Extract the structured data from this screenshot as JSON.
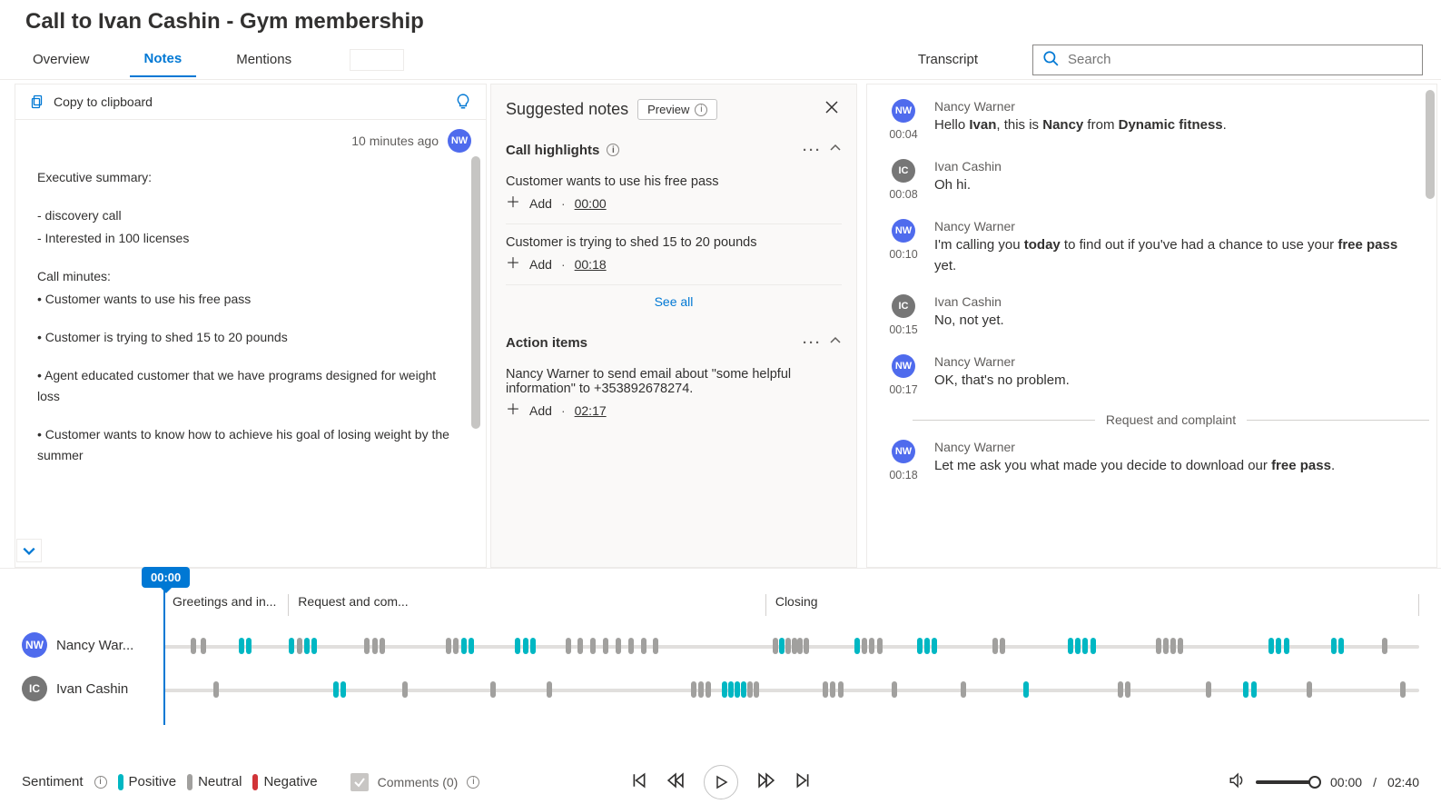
{
  "header": {
    "title": "Call to Ivan Cashin - Gym membership"
  },
  "tabs": {
    "overview": "Overview",
    "notes": "Notes",
    "mentions": "Mentions",
    "active": "notes"
  },
  "transcript_label": "Transcript",
  "search": {
    "placeholder": "Search"
  },
  "notes": {
    "copy_label": "Copy to clipboard",
    "meta": {
      "ago": "10 minutes ago",
      "initials": "NW"
    },
    "body_lines": [
      "Executive summary:",
      "",
      "- discovery call",
      "- Interested in 100 licenses",
      "",
      "Call minutes:",
      "• Customer wants to use his free pass",
      "",
      "• Customer is trying to shed 15 to 20 pounds",
      "",
      "• Agent educated customer that we have programs designed for weight loss",
      "",
      "• Customer wants to know how to achieve his goal of losing weight by the summer"
    ]
  },
  "suggested": {
    "title": "Suggested notes",
    "preview_label": "Preview",
    "highlights_title": "Call highlights",
    "action_items_title": "Action items",
    "add_label": "Add",
    "see_all": "See all",
    "highlights": [
      {
        "text": "Customer wants to use his free pass",
        "time": "00:00"
      },
      {
        "text": "Customer is trying to shed 15 to 20 pounds",
        "time": "00:18"
      }
    ],
    "action_items": [
      {
        "text": "Nancy Warner to send email about \"some helpful information\" to +353892678274.",
        "time": "02:17"
      }
    ]
  },
  "transcript": {
    "turns": [
      {
        "initials": "NW",
        "color": "blue",
        "name": "Nancy Warner",
        "time": "00:04",
        "html": "Hello <b>Ivan</b>, this is <b>Nancy</b> from <b>Dynamic fitness</b>."
      },
      {
        "initials": "IC",
        "color": "grey",
        "name": "Ivan Cashin",
        "time": "00:08",
        "html": "Oh hi."
      },
      {
        "initials": "NW",
        "color": "blue",
        "name": "Nancy Warner",
        "time": "00:10",
        "html": "I'm calling you <b>today</b> to find out if you've had a chance to use your <b>free pass</b> yet."
      },
      {
        "initials": "IC",
        "color": "grey",
        "name": "Ivan Cashin",
        "time": "00:15",
        "html": "No, not yet."
      },
      {
        "initials": "NW",
        "color": "blue",
        "name": "Nancy Warner",
        "time": "00:17",
        "html": "OK, that's no problem."
      }
    ],
    "divider": "Request and complaint",
    "after_divider": [
      {
        "initials": "NW",
        "color": "blue",
        "name": "Nancy Warner",
        "time": "00:18",
        "html": "Let me ask you what made you decide to download our <b>free pass</b>."
      }
    ]
  },
  "timeline": {
    "play_time": "00:00",
    "segments": [
      {
        "label": "Greetings and in...",
        "widthPct": 10
      },
      {
        "label": "Request and com...",
        "widthPct": 38
      },
      {
        "label": "Closing",
        "widthPct": 52
      }
    ],
    "speakers": [
      {
        "initials": "NW",
        "color": "blue",
        "name": "Nancy War..."
      },
      {
        "initials": "IC",
        "color": "grey",
        "name": "Ivan Cashin"
      }
    ],
    "tracks": {
      "NW": [
        {
          "p": 2.2,
          "s": "neu"
        },
        {
          "p": 3.0,
          "s": "neu"
        },
        {
          "p": 6.0,
          "s": "pos"
        },
        {
          "p": 6.6,
          "s": "pos"
        },
        {
          "p": 10.0,
          "s": "pos"
        },
        {
          "p": 10.6,
          "s": "neu"
        },
        {
          "p": 11.2,
          "s": "pos"
        },
        {
          "p": 11.8,
          "s": "pos"
        },
        {
          "p": 16.0,
          "s": "neu"
        },
        {
          "p": 16.6,
          "s": "neu"
        },
        {
          "p": 17.2,
          "s": "neu"
        },
        {
          "p": 22.5,
          "s": "neu"
        },
        {
          "p": 23.1,
          "s": "neu"
        },
        {
          "p": 23.7,
          "s": "pos"
        },
        {
          "p": 24.3,
          "s": "pos"
        },
        {
          "p": 28.0,
          "s": "pos"
        },
        {
          "p": 28.6,
          "s": "pos"
        },
        {
          "p": 29.2,
          "s": "pos"
        },
        {
          "p": 32.0,
          "s": "neu"
        },
        {
          "p": 33.0,
          "s": "neu"
        },
        {
          "p": 34.0,
          "s": "neu"
        },
        {
          "p": 35.0,
          "s": "neu"
        },
        {
          "p": 36.0,
          "s": "neu"
        },
        {
          "p": 37.0,
          "s": "neu"
        },
        {
          "p": 38.0,
          "s": "neu"
        },
        {
          "p": 39.0,
          "s": "neu"
        },
        {
          "p": 48.5,
          "s": "neu"
        },
        {
          "p": 49.0,
          "s": "pos"
        },
        {
          "p": 49.5,
          "s": "neu"
        },
        {
          "p": 50.0,
          "s": "neu"
        },
        {
          "p": 50.5,
          "s": "neu"
        },
        {
          "p": 51.0,
          "s": "neu"
        },
        {
          "p": 55.0,
          "s": "pos"
        },
        {
          "p": 55.6,
          "s": "neu"
        },
        {
          "p": 56.2,
          "s": "neu"
        },
        {
          "p": 56.8,
          "s": "neu"
        },
        {
          "p": 60.0,
          "s": "pos"
        },
        {
          "p": 60.6,
          "s": "pos"
        },
        {
          "p": 61.2,
          "s": "pos"
        },
        {
          "p": 66.0,
          "s": "neu"
        },
        {
          "p": 66.6,
          "s": "neu"
        },
        {
          "p": 72.0,
          "s": "pos"
        },
        {
          "p": 72.6,
          "s": "pos"
        },
        {
          "p": 73.2,
          "s": "pos"
        },
        {
          "p": 73.8,
          "s": "pos"
        },
        {
          "p": 79.0,
          "s": "neu"
        },
        {
          "p": 79.6,
          "s": "neu"
        },
        {
          "p": 80.2,
          "s": "neu"
        },
        {
          "p": 80.8,
          "s": "neu"
        },
        {
          "p": 88.0,
          "s": "pos"
        },
        {
          "p": 88.6,
          "s": "pos"
        },
        {
          "p": 89.2,
          "s": "pos"
        },
        {
          "p": 93.0,
          "s": "pos"
        },
        {
          "p": 93.6,
          "s": "pos"
        },
        {
          "p": 97.0,
          "s": "neu"
        }
      ],
      "IC": [
        {
          "p": 4.0,
          "s": "neu"
        },
        {
          "p": 13.5,
          "s": "pos"
        },
        {
          "p": 14.1,
          "s": "pos"
        },
        {
          "p": 19.0,
          "s": "neu"
        },
        {
          "p": 26.0,
          "s": "neu"
        },
        {
          "p": 30.5,
          "s": "neu"
        },
        {
          "p": 42.0,
          "s": "neu"
        },
        {
          "p": 42.6,
          "s": "neu"
        },
        {
          "p": 43.2,
          "s": "neu"
        },
        {
          "p": 44.5,
          "s": "pos"
        },
        {
          "p": 45.0,
          "s": "pos"
        },
        {
          "p": 45.5,
          "s": "pos"
        },
        {
          "p": 46.0,
          "s": "pos"
        },
        {
          "p": 46.5,
          "s": "neu"
        },
        {
          "p": 47.0,
          "s": "neu"
        },
        {
          "p": 52.5,
          "s": "neu"
        },
        {
          "p": 53.1,
          "s": "neu"
        },
        {
          "p": 53.7,
          "s": "neu"
        },
        {
          "p": 58.0,
          "s": "neu"
        },
        {
          "p": 63.5,
          "s": "neu"
        },
        {
          "p": 68.5,
          "s": "pos"
        },
        {
          "p": 76.0,
          "s": "neu"
        },
        {
          "p": 76.6,
          "s": "neu"
        },
        {
          "p": 83.0,
          "s": "neu"
        },
        {
          "p": 86.0,
          "s": "pos"
        },
        {
          "p": 86.6,
          "s": "pos"
        },
        {
          "p": 91.0,
          "s": "neu"
        },
        {
          "p": 98.5,
          "s": "neu"
        }
      ]
    }
  },
  "footer": {
    "sentiment_label": "Sentiment",
    "positive": "Positive",
    "neutral": "Neutral",
    "negative": "Negative",
    "comments": "Comments (0)",
    "current": "00:00",
    "total": "02:40"
  }
}
